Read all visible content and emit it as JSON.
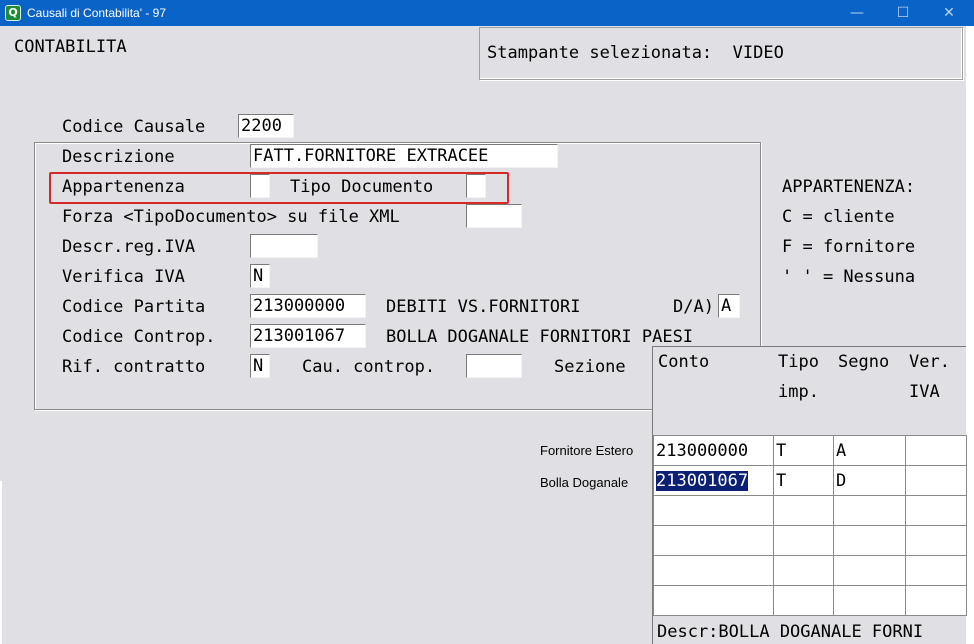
{
  "window": {
    "title": "Causali di Contabilita' - 97",
    "icon": "app-logo-icon",
    "min_symbol": "—",
    "max_symbol": "☐",
    "close_symbol": "✕"
  },
  "header": {
    "section": "CONTABILITA",
    "printer": "Stampante selezionata:  VIDEO"
  },
  "form": {
    "codice_causale": {
      "label": "Codice Causale",
      "value": "2200"
    },
    "descrizione": {
      "label": "Descrizione",
      "value": "FATT.FORNITORE EXTRACEE"
    },
    "appartenenza": {
      "label": "Appartenenza",
      "value": ""
    },
    "tipo_documento": {
      "label": "Tipo Documento",
      "value": ""
    },
    "forza_tipo": {
      "label": "Forza <TipoDocumento> su file XML",
      "value": ""
    },
    "descr_reg_iva": {
      "label": "Descr.reg.IVA",
      "value": ""
    },
    "verifica_iva": {
      "label": "Verifica IVA",
      "value": "N"
    },
    "codice_partita": {
      "label": "Codice Partita",
      "value": "213000000",
      "desc": "DEBITI VS.FORNITORI"
    },
    "da": {
      "label": "D/A)",
      "value": "A"
    },
    "codice_controp": {
      "label": "Codice Controp.",
      "value": "213001067",
      "desc": "BOLLA DOGANALE FORNITORI PAESI"
    },
    "rif_contratto": {
      "label": "Rif. contratto",
      "value": "N"
    },
    "cau_controp": {
      "label": "Cau. controp.",
      "value": ""
    },
    "sezione": {
      "label": "Sezione"
    }
  },
  "legend": {
    "title": "APPARTENENZA:",
    "c": "C = cliente",
    "f": "F = fornitore",
    "none": "' ' = Nessuna"
  },
  "grid": {
    "headers": {
      "conto": "Conto",
      "tipo": "Tipo",
      "imp": "imp.",
      "segno": "Segno",
      "ver": "Ver.",
      "iva": "IVA"
    },
    "row_labels": [
      "Fornitore Estero",
      "Bolla Doganale"
    ],
    "rows": [
      [
        "213000000",
        "T",
        "A",
        ""
      ],
      [
        "213001067",
        "T",
        "D",
        ""
      ],
      [
        "",
        "",
        "",
        ""
      ],
      [
        "",
        "",
        "",
        ""
      ],
      [
        "",
        "",
        "",
        ""
      ],
      [
        "",
        "",
        "",
        ""
      ]
    ],
    "status": "Descr:BOLLA DOGANALE FORNI"
  }
}
